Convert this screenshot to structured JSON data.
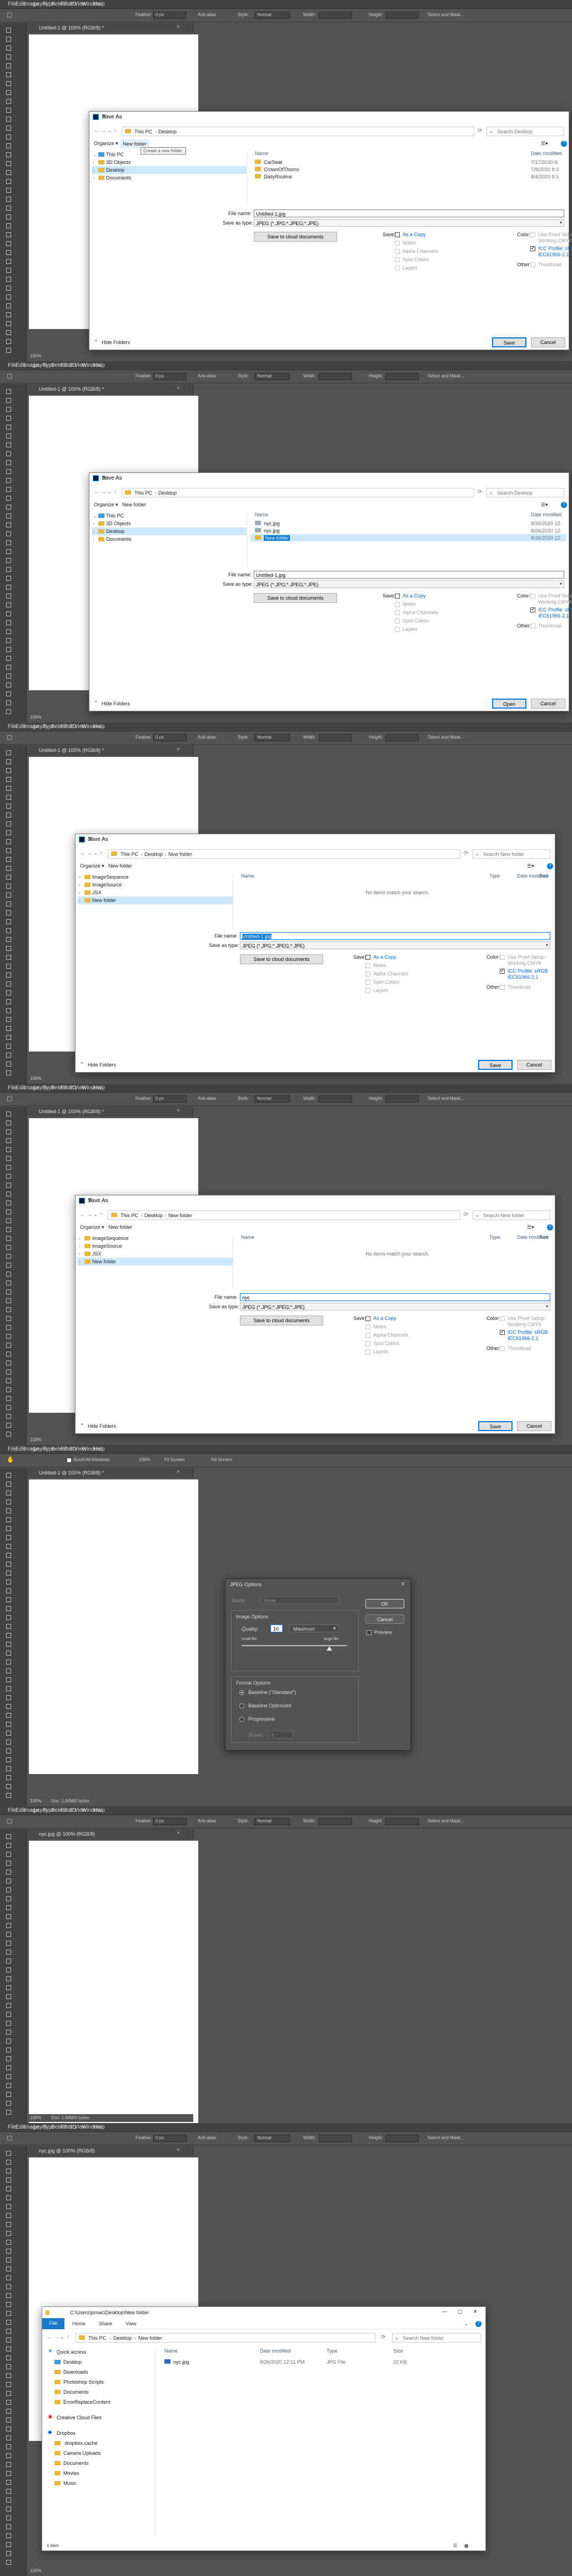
{
  "ps": {
    "menu": [
      "File",
      "Edit",
      "Image",
      "Layer",
      "Type",
      "Select",
      "Filter",
      "3D",
      "View",
      "Window",
      "Help"
    ],
    "options": {
      "feather_label": "Feather:",
      "feather_value": "0 px",
      "antialias": "Anti-alias",
      "style_label": "Style:",
      "style_value": "Normal",
      "width_label": "Width:",
      "height_label": "Height:",
      "select_mask": "Select and Mask..."
    },
    "options_hand": {
      "scroll_all": "Scroll All Windows",
      "zoom": "100%",
      "fit_screen": "Fit Screen",
      "fill_screen": "Fill Screen"
    },
    "doc_untitled": "Untitled-1 @ 100% (RGB/8) *",
    "doc_jpg": "nyc.jpg @ 100% (RGB/8)",
    "zoom": "100%",
    "doc_info": "Doc: 1.84M/0 bytes",
    "doc_info_jpg": "Doc: 1.84M/0 bytes"
  },
  "save_dialog": {
    "title": "Save As",
    "path_desktop": [
      "This PC",
      "Desktop"
    ],
    "path_newfolder": [
      "This PC",
      "Desktop",
      "New folder"
    ],
    "search_desktop": "Search Desktop",
    "search_newfolder": "Search New folder",
    "organize": "Organize ▾",
    "new_folder": "New folder",
    "tooltip": "Create a new folder.",
    "nav_items_1": [
      "This PC",
      "3D Objects",
      "Desktop",
      "Documents"
    ],
    "nav_items_3": [
      "ImageSequence",
      "ImageSource",
      "JSX",
      "New folder"
    ],
    "col_name": "Name",
    "col_date": "Date modified",
    "col_type": "Type",
    "col_size": "Size",
    "files_1": [
      {
        "name": "CarSeat",
        "date": "7/17/2020 6:"
      },
      {
        "name": "CrownOfThorns",
        "date": "7/9/2020 9:3"
      },
      {
        "name": "DailyRoutine",
        "date": "8/4/2020 9:1"
      }
    ],
    "files_2": [
      {
        "name": "nyc.jpg",
        "date": "8/26/2020 12:"
      },
      {
        "name": "nyc.jpg",
        "date": "8/26/2020 12:"
      },
      {
        "name": "New folder",
        "date": "8/26/2020 12:"
      }
    ],
    "empty_msg": "No items match your search.",
    "file_name_label": "File name:",
    "file_name_1": "Untitled-1.jpg",
    "file_name_4": "nyc",
    "save_type_label": "Save as type:",
    "save_type": "JPEG (*.JPG;*.JPEG;*.JPE)",
    "cloud_btn": "Save to cloud documents",
    "save_label": "Save:",
    "as_copy": "As a Copy",
    "notes": "Notes",
    "alpha": "Alpha Channels",
    "spot": "Spot Colors",
    "layers": "Layers",
    "color_label": "Color:",
    "proof": "Use Proof Setup:",
    "working": "Working CMYK",
    "icc": "ICC Profile: sRGB",
    "icc2": "IEC61966-2.1",
    "other_label": "Other:",
    "thumbnail": "Thumbnail",
    "hide_folders": "Hide Folders",
    "btn_save": "Save",
    "btn_open": "Open",
    "btn_cancel": "Cancel"
  },
  "jpeg_dialog": {
    "title": "JPEG Options",
    "matte_label": "Matte:",
    "matte_value": "None",
    "image_options": "Image Options",
    "quality_label": "Quality:",
    "quality_value": "10",
    "quality_level": "Maximum",
    "small_file": "small file",
    "large_file": "large file",
    "format_options": "Format Options",
    "formats": [
      "Baseline (\"Standard\")",
      "Baseline Optimized",
      "Progressive"
    ],
    "scans_label": "Scans:",
    "scans_value": "3",
    "ok": "OK",
    "cancel": "Cancel",
    "preview": "Preview",
    "quality_fraction": 0.83
  },
  "explorer": {
    "title_path": "C:\\Users\\jsmac\\Desktop\\New folder",
    "tabs": [
      "File",
      "Home",
      "Share",
      "View"
    ],
    "path": [
      "This PC",
      "Desktop",
      "New folder"
    ],
    "search": "Search New folder",
    "nav": [
      "Quick access",
      "Desktop",
      "Downloads",
      "Photoshop Scripts",
      "Documents",
      "ErrorReplaceContent",
      "Creative Cloud Files",
      "Dropbox",
      ".dropbox.cache",
      "Camera Uploads",
      "Documents",
      "Movies",
      "Music"
    ],
    "cols": [
      "Name",
      "Date modified",
      "Type",
      "Size"
    ],
    "file": {
      "name": "nyc.jpg",
      "date": "8/26/2020 12:11 PM",
      "type": "JPG File",
      "size": "22 KB"
    },
    "status": "1 item"
  },
  "colors": {
    "ps_bg": "#535353",
    "ps_dark": "#424242",
    "accent": "#0078d7",
    "select": "#cce8ff",
    "folder": "#e8b83e"
  }
}
